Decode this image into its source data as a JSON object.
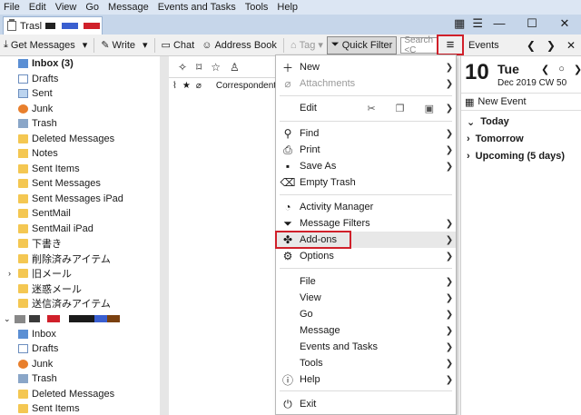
{
  "menubar": [
    "File",
    "Edit",
    "View",
    "Go",
    "Message",
    "Events and Tasks",
    "Tools",
    "Help"
  ],
  "tab": {
    "title": "Trasl"
  },
  "window": {
    "minimize": "—",
    "maximize": "☐",
    "close": "✕"
  },
  "toolbar": {
    "get_messages": "Get Messages",
    "write": "Write",
    "chat": "Chat",
    "address_book": "Address Book",
    "tag": "Tag",
    "quick_filter": "Quick Filter",
    "search_placeholder": "Search <C"
  },
  "events_panel": {
    "title": "Events",
    "day_number": "10",
    "weekday": "Tue",
    "month_year_week": "Dec 2019  CW 50",
    "new_event": "New Event",
    "groups": [
      "Today",
      "Tomorrow",
      "Upcoming (5 days)"
    ]
  },
  "folders": {
    "account1": [
      {
        "label": "Inbox (3)",
        "icon": "inbox",
        "bold": true
      },
      {
        "label": "Drafts",
        "icon": "drafts"
      },
      {
        "label": "Sent",
        "icon": "sent"
      },
      {
        "label": "Junk",
        "icon": "junk"
      },
      {
        "label": "Trash",
        "icon": "trash"
      },
      {
        "label": "Deleted Messages",
        "icon": "folder"
      },
      {
        "label": "Notes",
        "icon": "notes"
      },
      {
        "label": "Sent Items",
        "icon": "folder"
      },
      {
        "label": "Sent Messages",
        "icon": "folder"
      },
      {
        "label": "Sent Messages iPad",
        "icon": "folder"
      },
      {
        "label": "SentMail",
        "icon": "folder"
      },
      {
        "label": "SentMail iPad",
        "icon": "folder"
      },
      {
        "label": "下書き",
        "icon": "folder"
      },
      {
        "label": "削除済みアイテム",
        "icon": "folder"
      },
      {
        "label": "旧メール",
        "icon": "folder",
        "twisty": true
      },
      {
        "label": "迷惑メール",
        "icon": "folder"
      },
      {
        "label": "送信済みアイテム",
        "icon": "folder"
      }
    ],
    "account2": [
      {
        "label": "Inbox",
        "icon": "inbox"
      },
      {
        "label": "Drafts",
        "icon": "drafts"
      },
      {
        "label": "Junk",
        "icon": "junk"
      },
      {
        "label": "Trash",
        "icon": "trash"
      },
      {
        "label": "Deleted Messages",
        "icon": "folder"
      },
      {
        "label": "Sent Items",
        "icon": "folder"
      }
    ]
  },
  "message_list": {
    "column": "Correspondents"
  },
  "app_menu": {
    "new": "New",
    "attachments": "Attachments",
    "edit": "Edit",
    "find": "Find",
    "print": "Print",
    "save_as": "Save As",
    "empty_trash": "Empty Trash",
    "activity_manager": "Activity Manager",
    "message_filters": "Message Filters",
    "addons": "Add-ons",
    "options": "Options",
    "file": "File",
    "view": "View",
    "go": "Go",
    "message": "Message",
    "events_tasks": "Events and Tasks",
    "tools": "Tools",
    "help": "Help",
    "exit": "Exit"
  },
  "colors": {
    "highlight_border": "#d0202a",
    "folder": "#f4c752",
    "menubar": "#dce6f3"
  }
}
